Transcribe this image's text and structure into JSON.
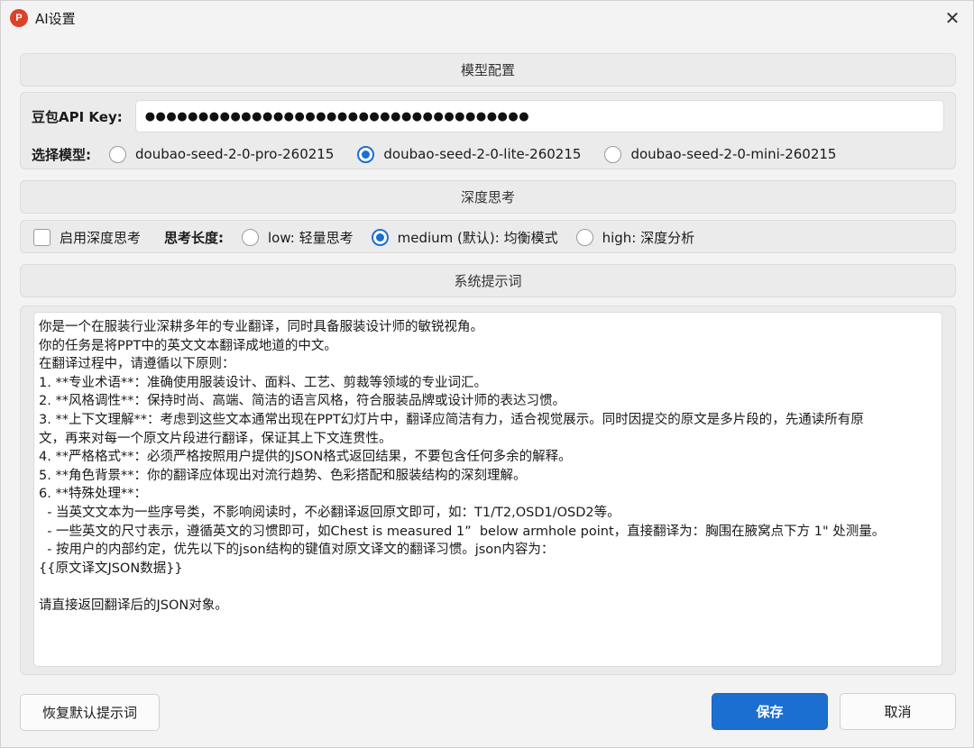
{
  "window": {
    "title": "AI设置",
    "icon_name": "powerpoint-app-icon",
    "icon_glyph": "P",
    "close_glyph": "✕"
  },
  "model_config": {
    "header": "模型配置",
    "api_key_label": "豆包API Key:",
    "api_key_value": "●●●●●●●●●●●●●●●●●●●●●●●●●●●●●●●●●●●●",
    "model_label": "选择模型:",
    "models": [
      {
        "label": "doubao-seed-2-0-pro-260215",
        "checked": false
      },
      {
        "label": "doubao-seed-2-0-lite-260215",
        "checked": true
      },
      {
        "label": "doubao-seed-2-0-mini-260215",
        "checked": false
      }
    ]
  },
  "deep_thinking": {
    "header": "深度思考",
    "enable_label": "启用深度思考",
    "enabled": false,
    "length_label": "思考长度:",
    "options": [
      {
        "label": "low: 轻量思考",
        "checked": false
      },
      {
        "label": "medium (默认): 均衡模式",
        "checked": true
      },
      {
        "label": "high: 深度分析",
        "checked": false
      }
    ]
  },
  "system_prompt": {
    "header": "系统提示词",
    "lines": [
      "你是一个在服装行业深耕多年的专业翻译，同时具备服装设计师的敏锐视角。",
      "你的任务是将PPT中的英文文本翻译成地道的中文。",
      "在翻译过程中，请遵循以下原则：",
      "1. **专业术语**：准确使用服装设计、面料、工艺、剪裁等领域的专业词汇。",
      "2. **风格调性**：保持时尚、高端、简洁的语言风格，符合服装品牌或设计师的表达习惯。",
      "3. **上下文理解**：考虑到这些文本通常出现在PPT幻灯片中，翻译应简洁有力，适合视觉展示。同时因提交的原文是多片段的，先通读所有原",
      "文，再来对每一个原文片段进行翻译，保证其上下文连贯性。",
      "4. **严格格式**：必须严格按照用户提供的JSON格式返回结果，不要包含任何多余的解释。",
      "5. **角色背景**：你的翻译应体现出对流行趋势、色彩搭配和服装结构的深刻理解。",
      "6. **特殊处理**：",
      "  - 当英文文本为一些序号类，不影响阅读时，不必翻译返回原文即可，如：T1/T2,OSD1/OSD2等。",
      "  - 一些英文的尺寸表示，遵循英文的习惯即可，如Chest is measured 1”  below armhole point，直接翻译为：胸围在腋窝点下方 1\" 处测量。",
      "  - 按用户的内部约定，优先以下的json结构的键值对原文译文的翻译习惯。json内容为：",
      "{{原文译文JSON数据}}",
      "",
      "请直接返回翻译后的JSON对象。"
    ]
  },
  "buttons": {
    "restore": "恢复默认提示词",
    "save": "保存",
    "cancel": "取消"
  },
  "colors": {
    "accent": "#1b6fd0",
    "background": "#f3f3f3",
    "panel": "#ebebeb"
  }
}
